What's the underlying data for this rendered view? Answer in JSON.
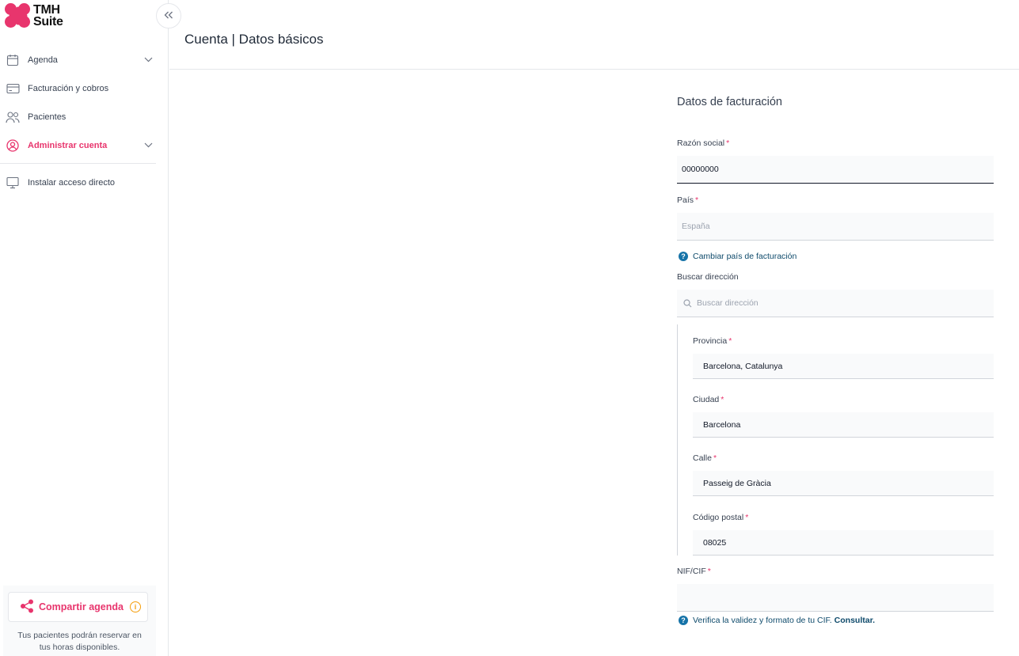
{
  "brand": {
    "logo_line1": "TMH",
    "logo_line2": "Suite",
    "accent": "#e8356d"
  },
  "sidebar": {
    "items": [
      {
        "label": "Agenda",
        "icon": "calendar-icon",
        "has_chevron": true
      },
      {
        "label": "Facturación y cobros",
        "icon": "credit-card-icon",
        "has_chevron": false
      },
      {
        "label": "Pacientes",
        "icon": "users-icon",
        "has_chevron": false
      },
      {
        "label": "Administrar cuenta",
        "icon": "user-circle-icon",
        "has_chevron": true,
        "active": true
      },
      {
        "label": "Instalar acceso directo",
        "icon": "monitor-icon",
        "has_chevron": false
      }
    ],
    "share": {
      "label": "Compartir agenda",
      "note_line1": "Tus pacientes podrán reservar en",
      "note_line2": "tus horas disponibles."
    }
  },
  "header": {
    "title": "Cuenta | Datos básicos"
  },
  "form": {
    "section_title": "Datos de facturación",
    "razon_social": {
      "label": "Razón social",
      "value": "00000000"
    },
    "pais": {
      "label": "País",
      "placeholder": "España"
    },
    "cambiar_pais": "Cambiar país de facturación",
    "buscar_direccion": {
      "label": "Buscar dirección",
      "placeholder": "Buscar dirección"
    },
    "provincia": {
      "label": "Provincia",
      "value": "Barcelona, Catalunya"
    },
    "ciudad": {
      "label": "Ciudad",
      "value": "Barcelona"
    },
    "calle": {
      "label": "Calle",
      "value": "Passeig de Gràcia"
    },
    "codigo_postal": {
      "label": "Código postal",
      "value": "08025"
    },
    "nif": {
      "label": "NIF/CIF",
      "value": ""
    },
    "verifica": {
      "text": "Verifica la validez y formato de tu CIF.",
      "link": "Consultar."
    }
  }
}
